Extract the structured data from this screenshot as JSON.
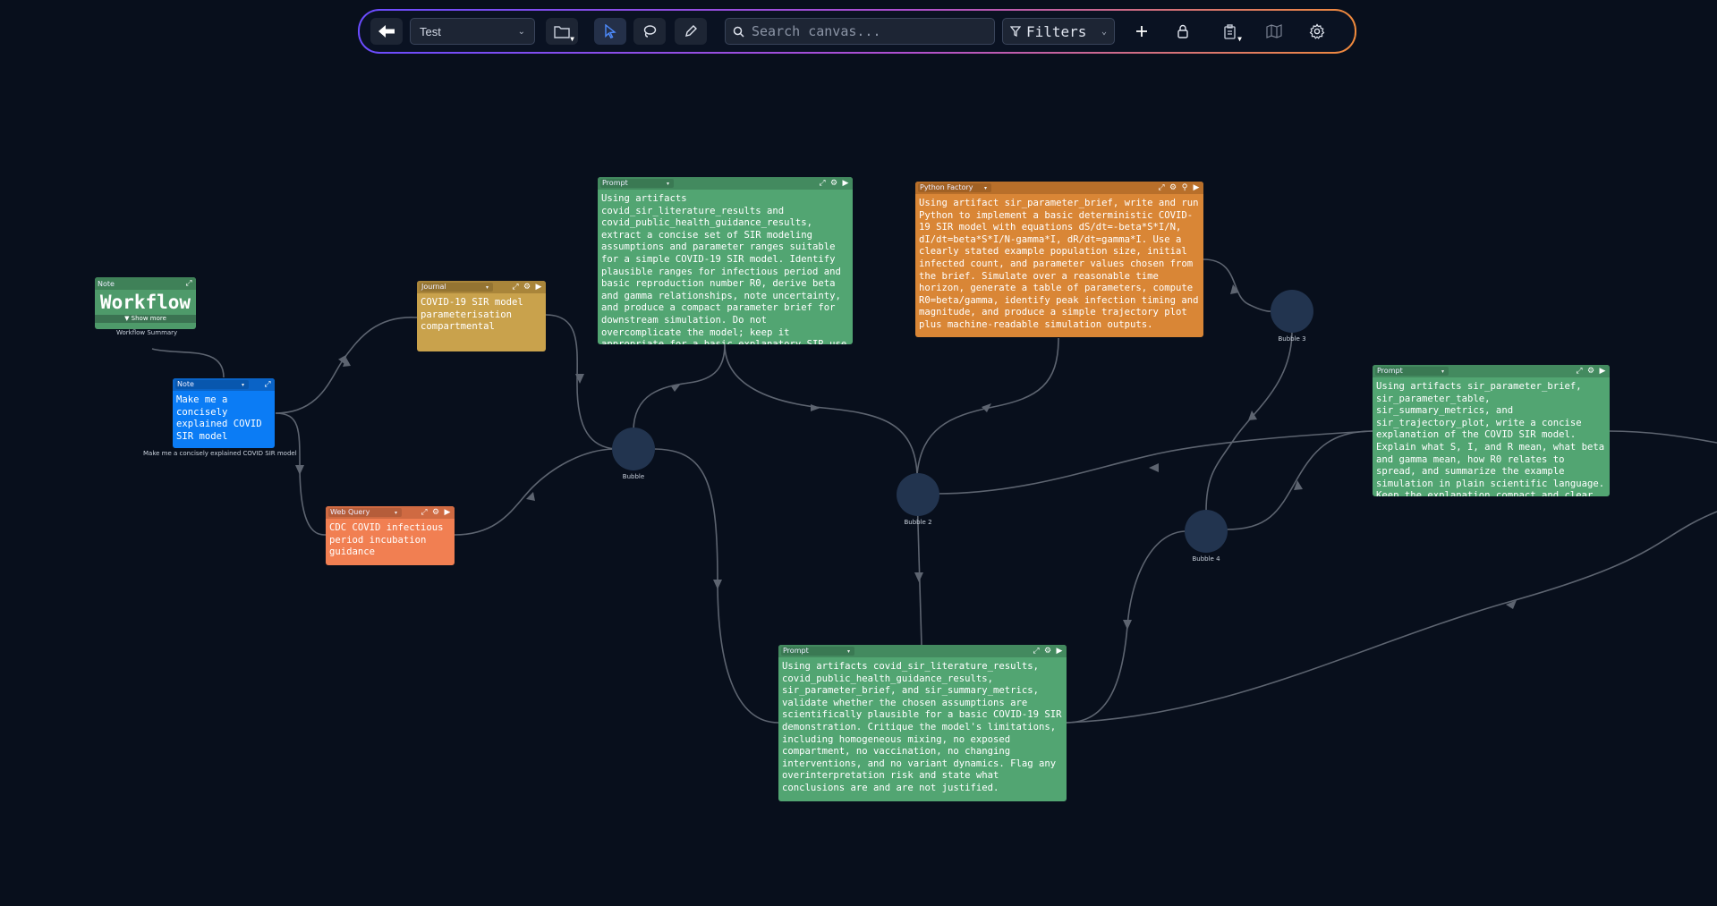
{
  "toolbar": {
    "project": "Test",
    "search_placeholder": "Search canvas...",
    "filters_label": "Filters"
  },
  "nodes": {
    "workflow_note": {
      "type": "Note",
      "text": "Workflow",
      "show_more": "▼ Show more",
      "caption": "Workflow Summary"
    },
    "user_note": {
      "type": "Note",
      "text": "Make me a concisely explained COVID SIR model",
      "caption": "Make me a concisely explained COVID SIR model"
    },
    "journal": {
      "type": "Journal",
      "text": "COVID-19 SIR model parameterisation compartmental"
    },
    "web_query": {
      "type": "Web Query",
      "text": "CDC COVID infectious period incubation guidance"
    },
    "prompt_1": {
      "type": "Prompt",
      "text": "Using artifacts covid_sir_literature_results and covid_public_health_guidance_results, extract a concise set of SIR modeling assumptions and parameter ranges suitable for a simple COVID-19 SIR model. Identify plausible ranges for infectious period and basic reproduction number R0, derive beta and gamma relationships, note uncertainty, and produce a compact parameter brief for downstream simulation. Do not overcomplicate the model; keep it appropriate for a basic explanatory SIR use case."
    },
    "python_factory": {
      "type": "Python Factory",
      "text": "Using artifact sir_parameter_brief, write and run Python to implement a basic deterministic COVID-19 SIR model with equations dS/dt=-beta*S*I/N, dI/dt=beta*S*I/N-gamma*I, dR/dt=gamma*I. Use a clearly stated example population size, initial infected count, and parameter values chosen from the brief. Simulate over a reasonable time horizon, generate a table of parameters, compute R0=beta/gamma, identify peak infection timing and magnitude, and produce a simple trajectory plot plus machine-readable simulation outputs."
    },
    "prompt_2": {
      "type": "Prompt",
      "text": "Using artifacts sir_parameter_brief, sir_parameter_table, sir_summary_metrics, and sir_trajectory_plot, write a concise explanation of the COVID SIR model. Explain what S, I, and R mean, what beta and gamma mean, how R0 relates to spread, and summarize the example simulation in plain scientific language. Keep the explanation compact and clear."
    },
    "prompt_3": {
      "type": "Prompt",
      "text": "Using artifacts covid_sir_literature_results, covid_public_health_guidance_results, sir_parameter_brief, and sir_summary_metrics, validate whether the chosen assumptions are scientifically plausible for a basic COVID-19 SIR demonstration. Critique the model's limitations, including homogeneous mixing, no exposed compartment, no vaccination, no changing interventions, and no variant dynamics. Flag any overinterpretation risk and state what conclusions are and are not justified."
    }
  },
  "bubbles": {
    "b1": "Bubble",
    "b2": "Bubble 2",
    "b3": "Bubble 3",
    "b4": "Bubble 4"
  },
  "colors": {
    "canvas": "#080f1c",
    "edge": "#5d6470",
    "note_green": "#4e9a6a",
    "note_blue": "#0b7cf5",
    "journal": "#c9a24c",
    "web_query": "#f17f52",
    "prompt": "#52a572",
    "python": "#d98636",
    "bubble": "#22344f"
  }
}
